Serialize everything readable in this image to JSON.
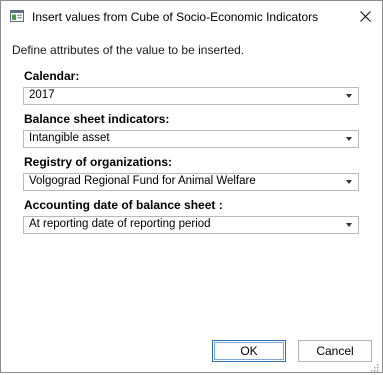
{
  "dialog": {
    "title": "Insert values from Cube of Socio-Economic Indicators",
    "description": "Define attributes of the value to be inserted."
  },
  "fields": [
    {
      "label": "Calendar:",
      "value": "2017"
    },
    {
      "label": "Balance sheet indicators:",
      "value": "Intangible asset"
    },
    {
      "label": "Registry of organizations:",
      "value": "Volgograd Regional Fund for Animal Welfare"
    },
    {
      "label": "Accounting date of balance sheet :",
      "value": "At reporting date of reporting period"
    }
  ],
  "buttons": {
    "ok": "OK",
    "cancel": "Cancel"
  },
  "icons": {
    "app": "window-icon",
    "close": "close-icon",
    "dropdown": "chevron-down-icon",
    "resize": "resize-grip-icon"
  }
}
